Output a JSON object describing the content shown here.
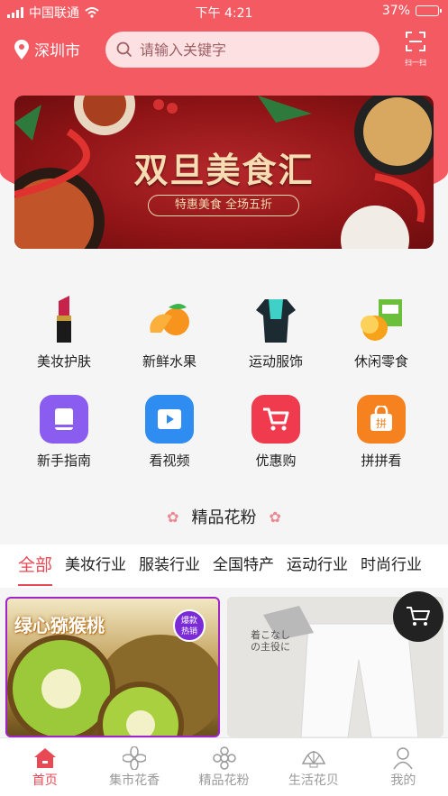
{
  "status_bar": {
    "carrier": "中国联通",
    "time": "下午 4:21",
    "battery": "37%",
    "battery_level": 0.37
  },
  "header": {
    "city": "深圳市",
    "search_placeholder": "请输入关键字",
    "scan_label": "扫一扫"
  },
  "banner": {
    "title": "双旦美食汇",
    "subtitle": "特惠美食 全场五折"
  },
  "categories": [
    {
      "label": "美妆护肤",
      "icon": "lipstick-icon"
    },
    {
      "label": "新鲜水果",
      "icon": "orange-icon"
    },
    {
      "label": "运动服饰",
      "icon": "jersey-icon"
    },
    {
      "label": "休闲零食",
      "icon": "snack-icon"
    },
    {
      "label": "新手指南",
      "icon": "book-icon",
      "color": "#8a5cf0"
    },
    {
      "label": "看视频",
      "icon": "video-icon",
      "color": "#2f8df2"
    },
    {
      "label": "优惠购",
      "icon": "cart-icon",
      "color": "#ef3b4d"
    },
    {
      "label": "拼拼看",
      "icon": "bag-icon",
      "color": "#f5821f"
    }
  ],
  "section": {
    "title": "精品花粉"
  },
  "tabs": [
    "全部",
    "美妆行业",
    "服装行业",
    "全国特产",
    "运动行业",
    "时尚行业"
  ],
  "products": [
    {
      "title": "绿心猕猴桃",
      "badge_line1": "爆款",
      "badge_line2": "热销"
    },
    {
      "caption": "着こなしの主役に"
    }
  ],
  "tabbar": [
    {
      "label": "首页",
      "icon": "home-icon",
      "active": true
    },
    {
      "label": "集市花香",
      "icon": "flower-icon"
    },
    {
      "label": "精品花粉",
      "icon": "blossom-icon"
    },
    {
      "label": "生活花贝",
      "icon": "shell-icon"
    },
    {
      "label": "我的",
      "icon": "user-icon"
    }
  ],
  "colors": {
    "brand": "#f45a61",
    "accent": "#e84a55"
  }
}
